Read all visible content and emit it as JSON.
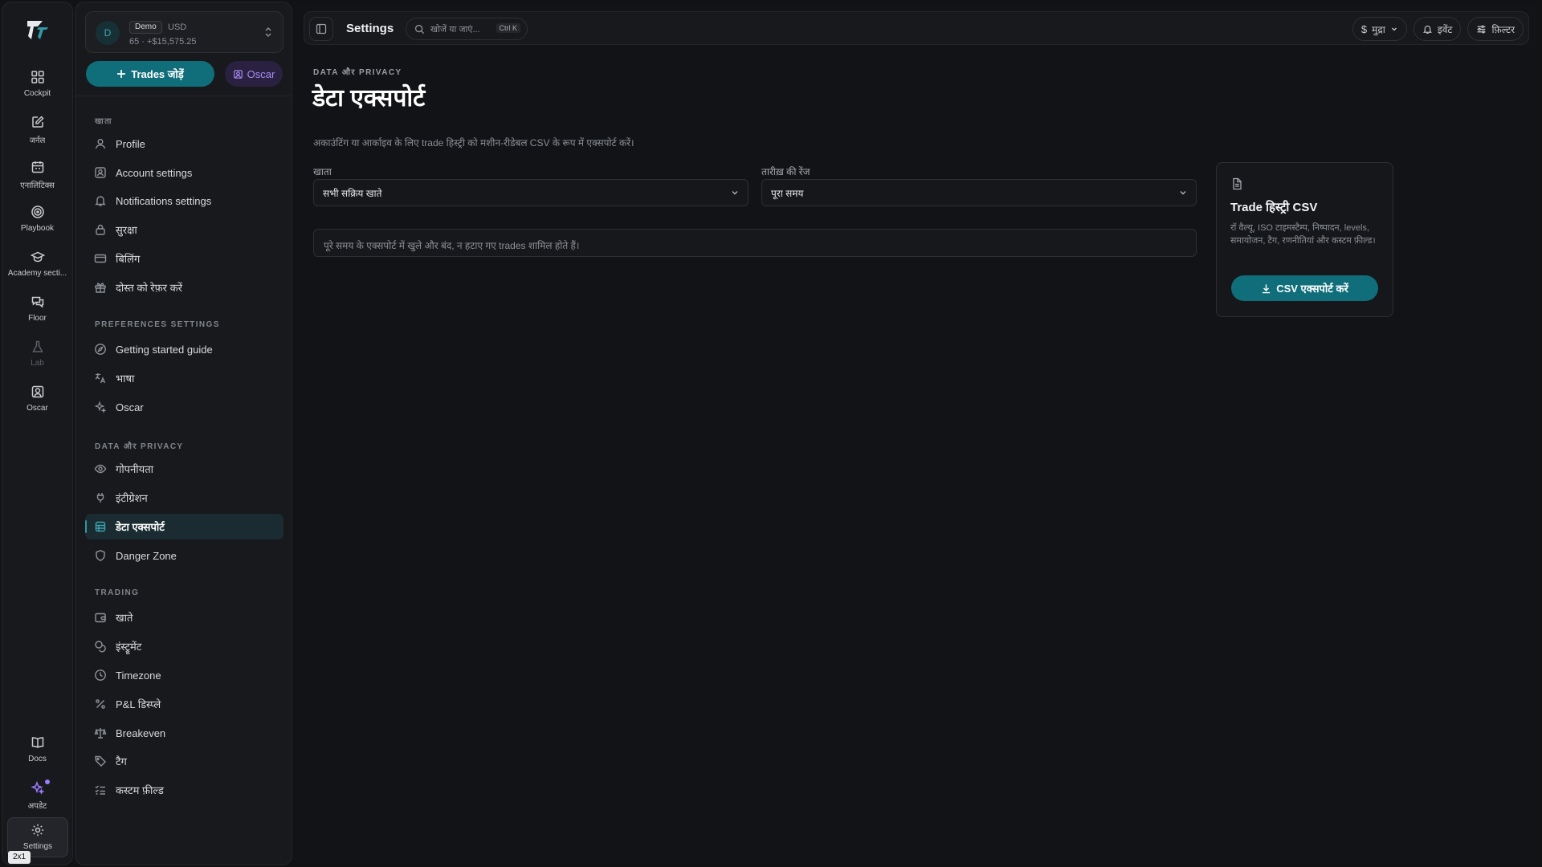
{
  "rail": {
    "items": [
      {
        "label": "Cockpit",
        "icon": "grid-icon"
      },
      {
        "label": "जर्नल",
        "icon": "journal-edit-icon"
      },
      {
        "label": "एनालिटिक्स",
        "icon": "calendar-icon"
      },
      {
        "label": "Playbook",
        "icon": "target-icon"
      },
      {
        "label": "Academy secti...",
        "icon": "graduation-cap-icon"
      },
      {
        "label": "Floor",
        "icon": "chat-bubbles-icon"
      },
      {
        "label": "Lab",
        "icon": "flask-icon"
      },
      {
        "label": "Oscar",
        "icon": "user-square-icon"
      }
    ],
    "docs_label": "Docs",
    "updates_label": "अपडेट",
    "settings_label": "Settings",
    "tooltip_badge": "2x1"
  },
  "account": {
    "avatar_letter": "D",
    "badge": "Demo",
    "currency": "USD",
    "balance": "65 · +$15,575.25"
  },
  "sidebar": {
    "add_trades_label": "Trades जोड़ें",
    "oscar_label": "Oscar",
    "sections": [
      {
        "heading": "खाता",
        "items": [
          {
            "label": "Profile",
            "icon": "user-icon"
          },
          {
            "label": "Account settings",
            "icon": "account-settings-icon"
          },
          {
            "label": "Notifications settings",
            "icon": "bell-icon"
          },
          {
            "label": "सुरक्षा",
            "icon": "lock-icon"
          },
          {
            "label": "बिलिंग",
            "icon": "credit-card-icon"
          },
          {
            "label": "दोस्त को रेफ़र करें",
            "icon": "gift-icon"
          }
        ]
      },
      {
        "heading": "PREFERENCES SETTINGS",
        "items": [
          {
            "label": "Getting started guide",
            "icon": "compass-icon"
          },
          {
            "label": "भाषा",
            "icon": "translate-icon"
          },
          {
            "label": "Oscar",
            "icon": "sparkles-icon"
          }
        ]
      },
      {
        "heading": "DATA और PRIVACY",
        "items": [
          {
            "label": "गोपनीयता",
            "icon": "eye-icon"
          },
          {
            "label": "इंटीग्रेशन",
            "icon": "plug-icon"
          },
          {
            "label": "डेटा एक्सपोर्ट",
            "icon": "database-icon"
          },
          {
            "label": "Danger Zone",
            "icon": "shield-icon"
          }
        ]
      },
      {
        "heading": "TRADING",
        "items": [
          {
            "label": "खाते",
            "icon": "wallet-icon"
          },
          {
            "label": "इंस्ट्रूमेंट",
            "icon": "coins-icon"
          },
          {
            "label": "Timezone",
            "icon": "clock-icon"
          },
          {
            "label": "P&L डिस्प्ले",
            "icon": "percent-icon"
          },
          {
            "label": "Breakeven",
            "icon": "scale-icon"
          },
          {
            "label": "टैग",
            "icon": "tag-icon"
          },
          {
            "label": "कस्टम फ़ील्ड",
            "icon": "checklist-icon"
          }
        ]
      }
    ]
  },
  "topbar": {
    "title": "Settings",
    "search_placeholder": "खोजें या जाएं...",
    "search_shortcut": "Ctrl K",
    "currency_label": "मुद्रा",
    "events_label": "इवेंट",
    "filter_label": "फ़िल्टर"
  },
  "page": {
    "eyebrow": "DATA और PRIVACY",
    "title": "डेटा एक्सपोर्ट",
    "description": "अकाउंटिंग या आर्काइव के लिए trade हिस्ट्री को मशीन-रीडेबल CSV के रूप में एक्सपोर्ट करें।",
    "account_field": {
      "label": "खाता",
      "value": "सभी सक्रिय खाते"
    },
    "range_field": {
      "label": "तारीख़ की रेंज",
      "value": "पूरा समय"
    },
    "info_text": "पूरे समय के एक्सपोर्ट में खुले और बंद, न हटाए गए trades शामिल होते हैं।",
    "card": {
      "title": "Trade हिस्ट्री CSV",
      "description": "रॉ वैल्यू, ISO टाइमस्टैम्प, निष्पादन, levels, समायोजन, टैग, रणनीतियां और कस्टम फ़ील्ड।",
      "button_label": "CSV एक्सपोर्ट करें"
    }
  },
  "colors": {
    "accent": "#0f6e7a",
    "oscar_purple": "#a98cf5",
    "background": "#111214"
  }
}
